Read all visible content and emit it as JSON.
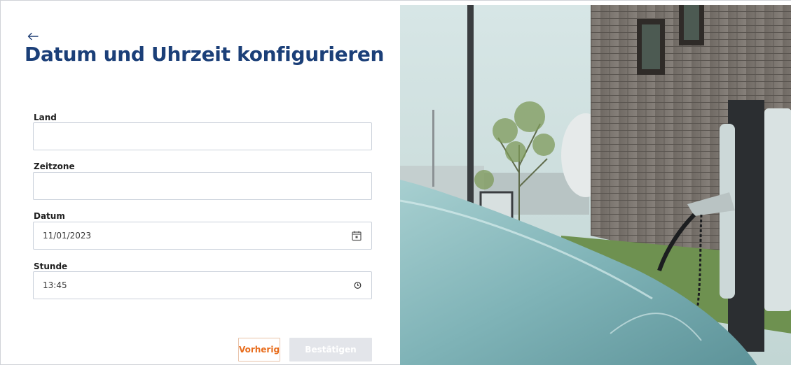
{
  "page": {
    "back_icon": "arrow-left-icon",
    "title": "Datum und Uhrzeit konfigurieren"
  },
  "form": {
    "land": {
      "label": "Land",
      "value": ""
    },
    "zeitzone": {
      "label": "Zeitzone",
      "value": ""
    },
    "datum": {
      "label": "Datum",
      "value": "11/01/2023",
      "icon": "calendar-icon"
    },
    "stunde": {
      "label": "Stunde",
      "value": "13:45",
      "icon": "clock-icon"
    }
  },
  "actions": {
    "previous_label": "Vorherig",
    "confirm_label": "Bestätigen"
  },
  "colors": {
    "title": "#1b3f78",
    "accent_orange": "#e86d1d",
    "disabled_button": "#e3e5ea",
    "field_border": "#c9d0da"
  },
  "image": {
    "description_icon": "ev-charging-station-photo"
  }
}
